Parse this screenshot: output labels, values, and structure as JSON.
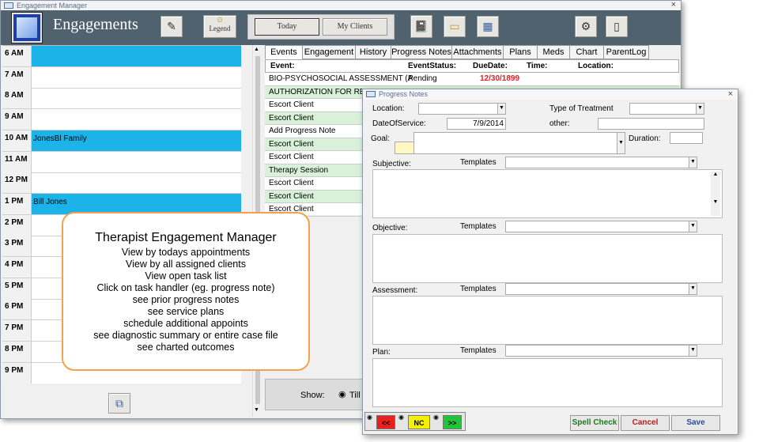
{
  "main_window": {
    "title": "Engagement Manager",
    "close": "×",
    "header_title": "Engagements",
    "legend_label": "Legend",
    "today_label": "Today",
    "my_clients_label": "My Clients"
  },
  "schedule": [
    {
      "time": "6 AM",
      "text": "",
      "highlight": true
    },
    {
      "time": "7 AM",
      "text": "",
      "highlight": false
    },
    {
      "time": "8 AM",
      "text": "",
      "highlight": false
    },
    {
      "time": "9 AM",
      "text": "",
      "highlight": false
    },
    {
      "time": "10 AM",
      "text": "JonesBl Family",
      "highlight": true
    },
    {
      "time": "11 AM",
      "text": "",
      "highlight": false
    },
    {
      "time": "12 PM",
      "text": "",
      "highlight": false
    },
    {
      "time": "1 PM",
      "text": "Bill Jones",
      "highlight": true
    },
    {
      "time": "2 PM",
      "text": "",
      "highlight": false
    },
    {
      "time": "3 PM",
      "text": "",
      "highlight": false
    },
    {
      "time": "4 PM",
      "text": "",
      "highlight": false
    },
    {
      "time": "5 PM",
      "text": "",
      "highlight": false
    },
    {
      "time": "6 PM",
      "text": "",
      "highlight": false
    },
    {
      "time": "7 PM",
      "text": "",
      "highlight": false
    },
    {
      "time": "8 PM",
      "text": "",
      "highlight": false
    },
    {
      "time": "9 PM",
      "text": "",
      "highlight": false
    }
  ],
  "tabs": [
    "Events",
    "Engagement",
    "History",
    "Progress Notes",
    "Attachments",
    "Plans",
    "Meds",
    "Chart",
    "ParentLog"
  ],
  "events_header": {
    "event": "Event:",
    "status": "EventStatus:",
    "due": "DueDate:",
    "time": "Time:",
    "location": "Location:"
  },
  "events": [
    {
      "name": "BIO-PSYCHOSOCIAL ASSESSMENT (A",
      "status": "Pending",
      "due": "12/30/1899"
    },
    {
      "name": "AUTHORIZATION FOR RE",
      "status": "",
      "due": ""
    },
    {
      "name": "Escort Client",
      "status": "",
      "due": ""
    },
    {
      "name": "Escort Client",
      "status": "",
      "due": ""
    },
    {
      "name": "Add Progress Note",
      "status": "",
      "due": ""
    },
    {
      "name": "Escort Client",
      "status": "",
      "due": ""
    },
    {
      "name": "Escort Client",
      "status": "",
      "due": ""
    },
    {
      "name": "Therapy Session",
      "status": "",
      "due": ""
    },
    {
      "name": "Escort Client",
      "status": "",
      "due": ""
    },
    {
      "name": "Escort Client",
      "status": "",
      "due": ""
    },
    {
      "name": "Escort Client",
      "status": "",
      "due": ""
    }
  ],
  "show_bar": {
    "label": "Show:",
    "option": "Till"
  },
  "callout": {
    "title": "Therapist Engagement Manager",
    "lines": [
      "View by todays appointments",
      "View by all assigned clients",
      "View open task list",
      "Click on task handler (eg. progress note)",
      "see prior progress notes",
      "see service plans",
      "schedule additional appoints",
      "see diagnostic summary or entire case file",
      "see charted outcomes"
    ]
  },
  "progress_notes": {
    "title": "Progress Notes",
    "close": "×",
    "location_label": "Location:",
    "treatment_label": "Type of Treatment",
    "dos_label": "DateOfService:",
    "dos_value": "7/9/2014",
    "other_label": "other:",
    "goal_label": "Goal:",
    "duration_label": "Duration:",
    "subjective_label": "Subjective:",
    "objective_label": "Objective:",
    "assessment_label": "Assessment:",
    "plan_label": "Plan:",
    "templates_label": "Templates",
    "nav_prev": "<<",
    "nav_nc": "NC",
    "nav_next": ">>",
    "spell_check": "Spell Check",
    "cancel": "Cancel",
    "save": "Save"
  },
  "colors": {
    "header": "#51626f",
    "highlight": "#1cb3e8",
    "event_green": "#d9f1d9",
    "callout_border": "#f2a24a",
    "pending_red": "#e02020"
  }
}
